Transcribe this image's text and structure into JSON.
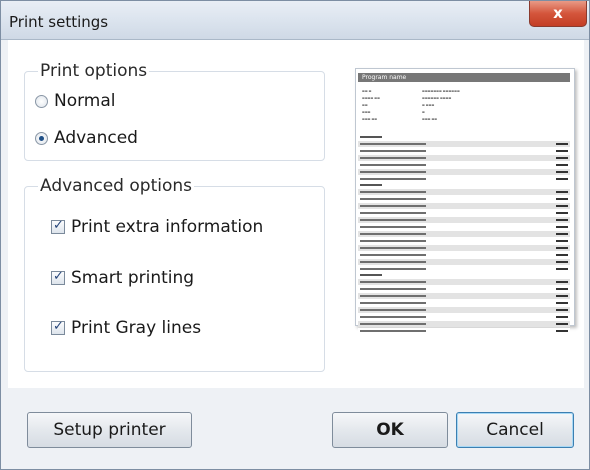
{
  "window": {
    "title": "Print settings",
    "close_glyph": "x"
  },
  "print_options": {
    "label": "Print options",
    "options": [
      {
        "label": "Normal",
        "selected": false
      },
      {
        "label": "Advanced",
        "selected": true
      }
    ]
  },
  "advanced_options": {
    "label": "Advanced options",
    "checkboxes": [
      {
        "label": "Print extra information",
        "checked": true
      },
      {
        "label": "Smart printing",
        "checked": true
      },
      {
        "label": "Print Gray lines",
        "checked": true
      }
    ]
  },
  "preview": {
    "header": "Program name"
  },
  "buttons": {
    "setup_printer": "Setup printer",
    "ok": "OK",
    "cancel": "Cancel"
  },
  "colors": {
    "accent": "#3c7fb1",
    "close": "#c33e25"
  }
}
